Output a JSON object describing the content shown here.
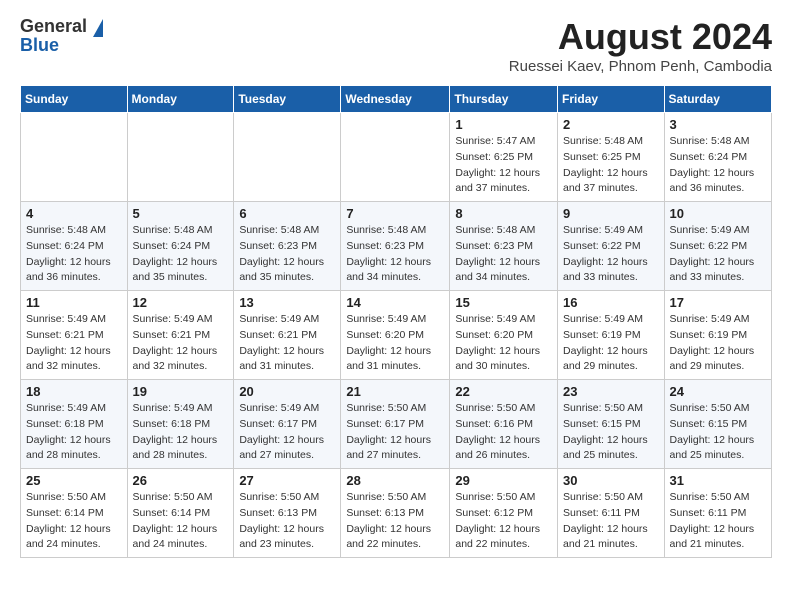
{
  "header": {
    "logo_general": "General",
    "logo_blue": "Blue",
    "month_title": "August 2024",
    "location": "Ruessei Kaev, Phnom Penh, Cambodia"
  },
  "weekdays": [
    "Sunday",
    "Monday",
    "Tuesday",
    "Wednesday",
    "Thursday",
    "Friday",
    "Saturday"
  ],
  "weeks": [
    [
      {
        "day": "",
        "sunrise": "",
        "sunset": "",
        "daylight": ""
      },
      {
        "day": "",
        "sunrise": "",
        "sunset": "",
        "daylight": ""
      },
      {
        "day": "",
        "sunrise": "",
        "sunset": "",
        "daylight": ""
      },
      {
        "day": "",
        "sunrise": "",
        "sunset": "",
        "daylight": ""
      },
      {
        "day": "1",
        "sunrise": "Sunrise: 5:47 AM",
        "sunset": "Sunset: 6:25 PM",
        "daylight": "Daylight: 12 hours and 37 minutes."
      },
      {
        "day": "2",
        "sunrise": "Sunrise: 5:48 AM",
        "sunset": "Sunset: 6:25 PM",
        "daylight": "Daylight: 12 hours and 37 minutes."
      },
      {
        "day": "3",
        "sunrise": "Sunrise: 5:48 AM",
        "sunset": "Sunset: 6:24 PM",
        "daylight": "Daylight: 12 hours and 36 minutes."
      }
    ],
    [
      {
        "day": "4",
        "sunrise": "Sunrise: 5:48 AM",
        "sunset": "Sunset: 6:24 PM",
        "daylight": "Daylight: 12 hours and 36 minutes."
      },
      {
        "day": "5",
        "sunrise": "Sunrise: 5:48 AM",
        "sunset": "Sunset: 6:24 PM",
        "daylight": "Daylight: 12 hours and 35 minutes."
      },
      {
        "day": "6",
        "sunrise": "Sunrise: 5:48 AM",
        "sunset": "Sunset: 6:23 PM",
        "daylight": "Daylight: 12 hours and 35 minutes."
      },
      {
        "day": "7",
        "sunrise": "Sunrise: 5:48 AM",
        "sunset": "Sunset: 6:23 PM",
        "daylight": "Daylight: 12 hours and 34 minutes."
      },
      {
        "day": "8",
        "sunrise": "Sunrise: 5:48 AM",
        "sunset": "Sunset: 6:23 PM",
        "daylight": "Daylight: 12 hours and 34 minutes."
      },
      {
        "day": "9",
        "sunrise": "Sunrise: 5:49 AM",
        "sunset": "Sunset: 6:22 PM",
        "daylight": "Daylight: 12 hours and 33 minutes."
      },
      {
        "day": "10",
        "sunrise": "Sunrise: 5:49 AM",
        "sunset": "Sunset: 6:22 PM",
        "daylight": "Daylight: 12 hours and 33 minutes."
      }
    ],
    [
      {
        "day": "11",
        "sunrise": "Sunrise: 5:49 AM",
        "sunset": "Sunset: 6:21 PM",
        "daylight": "Daylight: 12 hours and 32 minutes."
      },
      {
        "day": "12",
        "sunrise": "Sunrise: 5:49 AM",
        "sunset": "Sunset: 6:21 PM",
        "daylight": "Daylight: 12 hours and 32 minutes."
      },
      {
        "day": "13",
        "sunrise": "Sunrise: 5:49 AM",
        "sunset": "Sunset: 6:21 PM",
        "daylight": "Daylight: 12 hours and 31 minutes."
      },
      {
        "day": "14",
        "sunrise": "Sunrise: 5:49 AM",
        "sunset": "Sunset: 6:20 PM",
        "daylight": "Daylight: 12 hours and 31 minutes."
      },
      {
        "day": "15",
        "sunrise": "Sunrise: 5:49 AM",
        "sunset": "Sunset: 6:20 PM",
        "daylight": "Daylight: 12 hours and 30 minutes."
      },
      {
        "day": "16",
        "sunrise": "Sunrise: 5:49 AM",
        "sunset": "Sunset: 6:19 PM",
        "daylight": "Daylight: 12 hours and 29 minutes."
      },
      {
        "day": "17",
        "sunrise": "Sunrise: 5:49 AM",
        "sunset": "Sunset: 6:19 PM",
        "daylight": "Daylight: 12 hours and 29 minutes."
      }
    ],
    [
      {
        "day": "18",
        "sunrise": "Sunrise: 5:49 AM",
        "sunset": "Sunset: 6:18 PM",
        "daylight": "Daylight: 12 hours and 28 minutes."
      },
      {
        "day": "19",
        "sunrise": "Sunrise: 5:49 AM",
        "sunset": "Sunset: 6:18 PM",
        "daylight": "Daylight: 12 hours and 28 minutes."
      },
      {
        "day": "20",
        "sunrise": "Sunrise: 5:49 AM",
        "sunset": "Sunset: 6:17 PM",
        "daylight": "Daylight: 12 hours and 27 minutes."
      },
      {
        "day": "21",
        "sunrise": "Sunrise: 5:50 AM",
        "sunset": "Sunset: 6:17 PM",
        "daylight": "Daylight: 12 hours and 27 minutes."
      },
      {
        "day": "22",
        "sunrise": "Sunrise: 5:50 AM",
        "sunset": "Sunset: 6:16 PM",
        "daylight": "Daylight: 12 hours and 26 minutes."
      },
      {
        "day": "23",
        "sunrise": "Sunrise: 5:50 AM",
        "sunset": "Sunset: 6:15 PM",
        "daylight": "Daylight: 12 hours and 25 minutes."
      },
      {
        "day": "24",
        "sunrise": "Sunrise: 5:50 AM",
        "sunset": "Sunset: 6:15 PM",
        "daylight": "Daylight: 12 hours and 25 minutes."
      }
    ],
    [
      {
        "day": "25",
        "sunrise": "Sunrise: 5:50 AM",
        "sunset": "Sunset: 6:14 PM",
        "daylight": "Daylight: 12 hours and 24 minutes."
      },
      {
        "day": "26",
        "sunrise": "Sunrise: 5:50 AM",
        "sunset": "Sunset: 6:14 PM",
        "daylight": "Daylight: 12 hours and 24 minutes."
      },
      {
        "day": "27",
        "sunrise": "Sunrise: 5:50 AM",
        "sunset": "Sunset: 6:13 PM",
        "daylight": "Daylight: 12 hours and 23 minutes."
      },
      {
        "day": "28",
        "sunrise": "Sunrise: 5:50 AM",
        "sunset": "Sunset: 6:13 PM",
        "daylight": "Daylight: 12 hours and 22 minutes."
      },
      {
        "day": "29",
        "sunrise": "Sunrise: 5:50 AM",
        "sunset": "Sunset: 6:12 PM",
        "daylight": "Daylight: 12 hours and 22 minutes."
      },
      {
        "day": "30",
        "sunrise": "Sunrise: 5:50 AM",
        "sunset": "Sunset: 6:11 PM",
        "daylight": "Daylight: 12 hours and 21 minutes."
      },
      {
        "day": "31",
        "sunrise": "Sunrise: 5:50 AM",
        "sunset": "Sunset: 6:11 PM",
        "daylight": "Daylight: 12 hours and 21 minutes."
      }
    ]
  ]
}
